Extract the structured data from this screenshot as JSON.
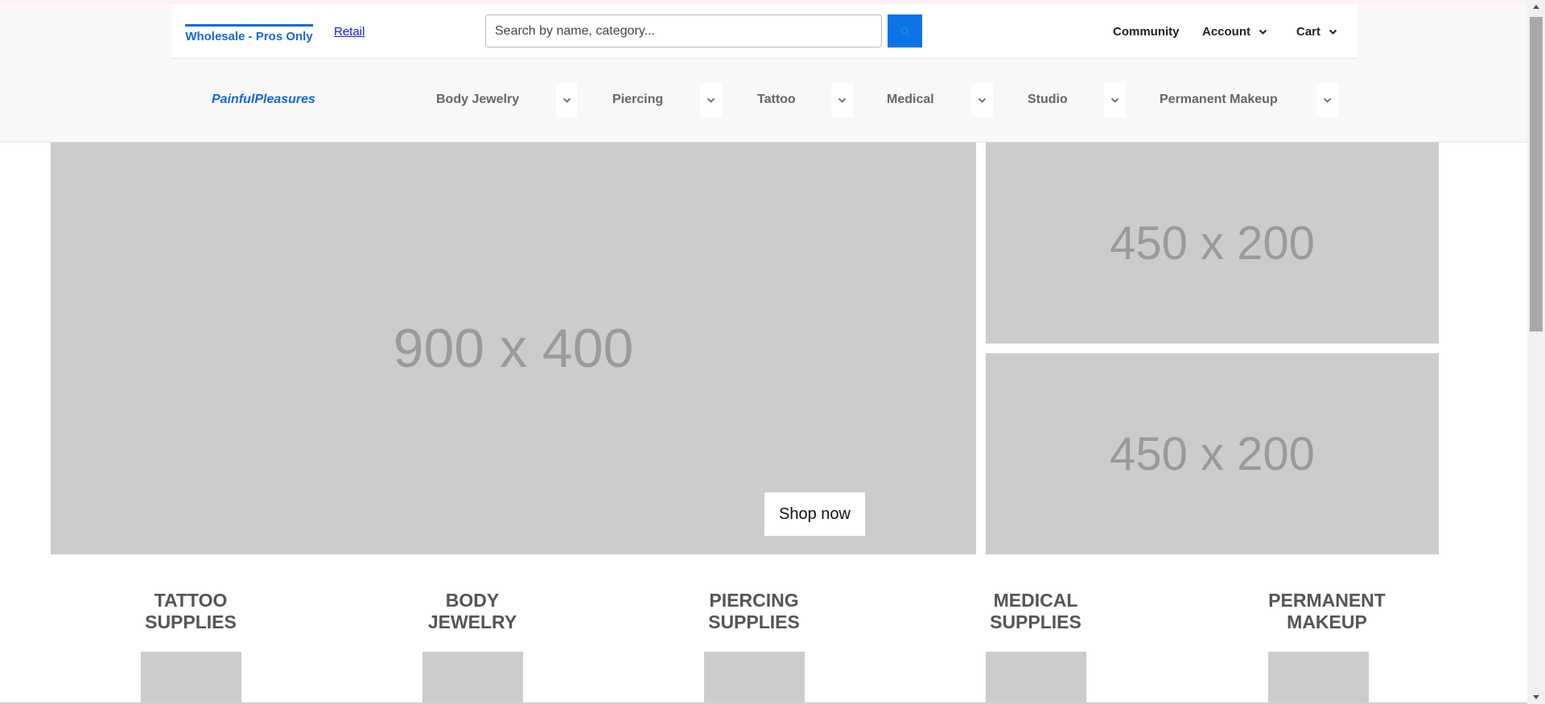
{
  "header": {
    "tabs": [
      {
        "label": "Wholesale - Pros Only",
        "active": true
      },
      {
        "label": "Retail",
        "active": false
      }
    ],
    "search": {
      "placeholder": "Search by name, category...",
      "value": "",
      "button_icon": "search-icon"
    },
    "nav": {
      "community": "Community",
      "account": "Account",
      "cart": "Cart"
    },
    "logo": "PainfulPleasures",
    "categories": [
      "Body Jewelry",
      "Piercing",
      "Tattoo",
      "Medical",
      "Studio",
      "Permanent Makeup"
    ]
  },
  "hero": {
    "main_placeholder": "900 x 400",
    "shop_now": "Shop now",
    "side_placeholders": [
      "450 x 200",
      "450 x 200"
    ]
  },
  "features": [
    {
      "line1": "TATTOO",
      "line2": "SUPPLIES"
    },
    {
      "line1": "BODY",
      "line2": "JEWELRY"
    },
    {
      "line1": "PIERCING",
      "line2": "SUPPLIES"
    },
    {
      "line1": "MEDICAL",
      "line2": "SUPPLIES"
    },
    {
      "line1": "PERMANENT",
      "line2": "MAKEUP"
    }
  ],
  "colors": {
    "accent": "#1168d8",
    "search_button": "#0d73e8",
    "placeholder_bg": "#cccccc",
    "placeholder_text": "#9a9a9a",
    "header_bg": "#f8f8f8",
    "heading_gray": "#555555"
  }
}
